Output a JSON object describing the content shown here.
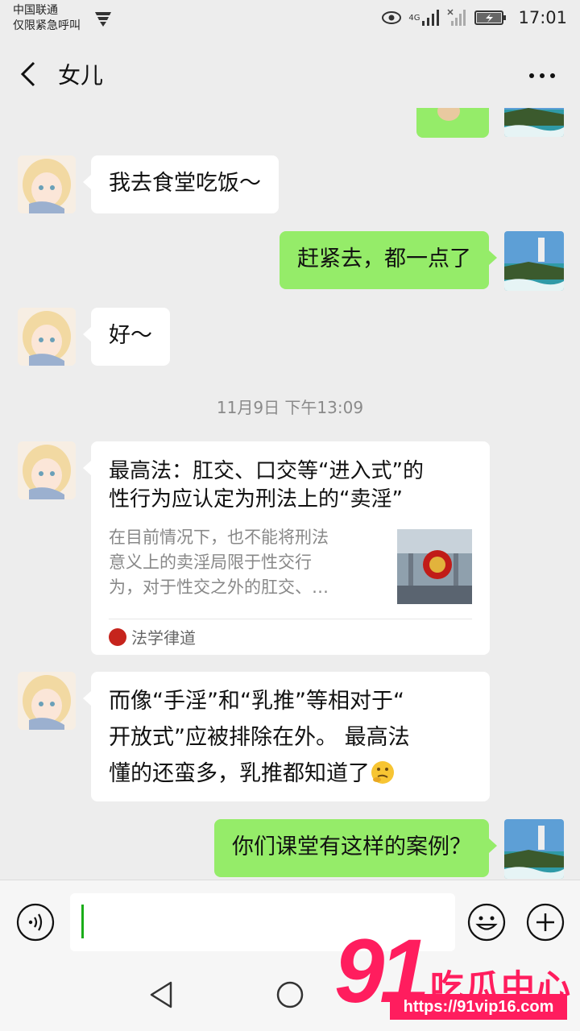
{
  "status_bar": {
    "carrier": "中国联通",
    "carrier_note": "仅限紧急呼叫",
    "network": "4G",
    "time": "17:01"
  },
  "header": {
    "title": "女儿"
  },
  "messages": [
    {
      "side": "right",
      "type": "image-partial"
    },
    {
      "side": "left",
      "text": "我去食堂吃饭～"
    },
    {
      "side": "right",
      "text": "赶紧去，都一点了"
    },
    {
      "side": "left",
      "text": "好～"
    },
    {
      "type": "timestamp",
      "text": "11月9日 下午13:09"
    },
    {
      "side": "left",
      "type": "article-card",
      "title_line1": "最高法：肛交、口交等“进入式”的",
      "title_line2": "性行为应认定为刑法上的“卖淫”",
      "desc_line1": "在目前情况下，也不能将刑法",
      "desc_line2": "意义上的卖淫局限于性交行",
      "desc_line3": "为，对于性交之外的肛交、…",
      "source": "法学律道"
    },
    {
      "side": "left",
      "line1": "而像“手淫”和“乳推”等相对于“",
      "line2": "开放式”应被排除在外。 最高法",
      "line3": "懂的还蛮多，乳推都知道了",
      "emoji": "thinking-face"
    },
    {
      "side": "right",
      "text": "你们课堂有这样的案例？"
    }
  ],
  "input": {
    "value": ""
  },
  "watermark": {
    "number": "91",
    "text": "吃瓜中心",
    "url": "https://91vip16.com"
  },
  "colors": {
    "background": "#ededed",
    "bubble_self": "#95ec69",
    "bubble_other": "#ffffff",
    "watermark": "#ff1d5e"
  }
}
